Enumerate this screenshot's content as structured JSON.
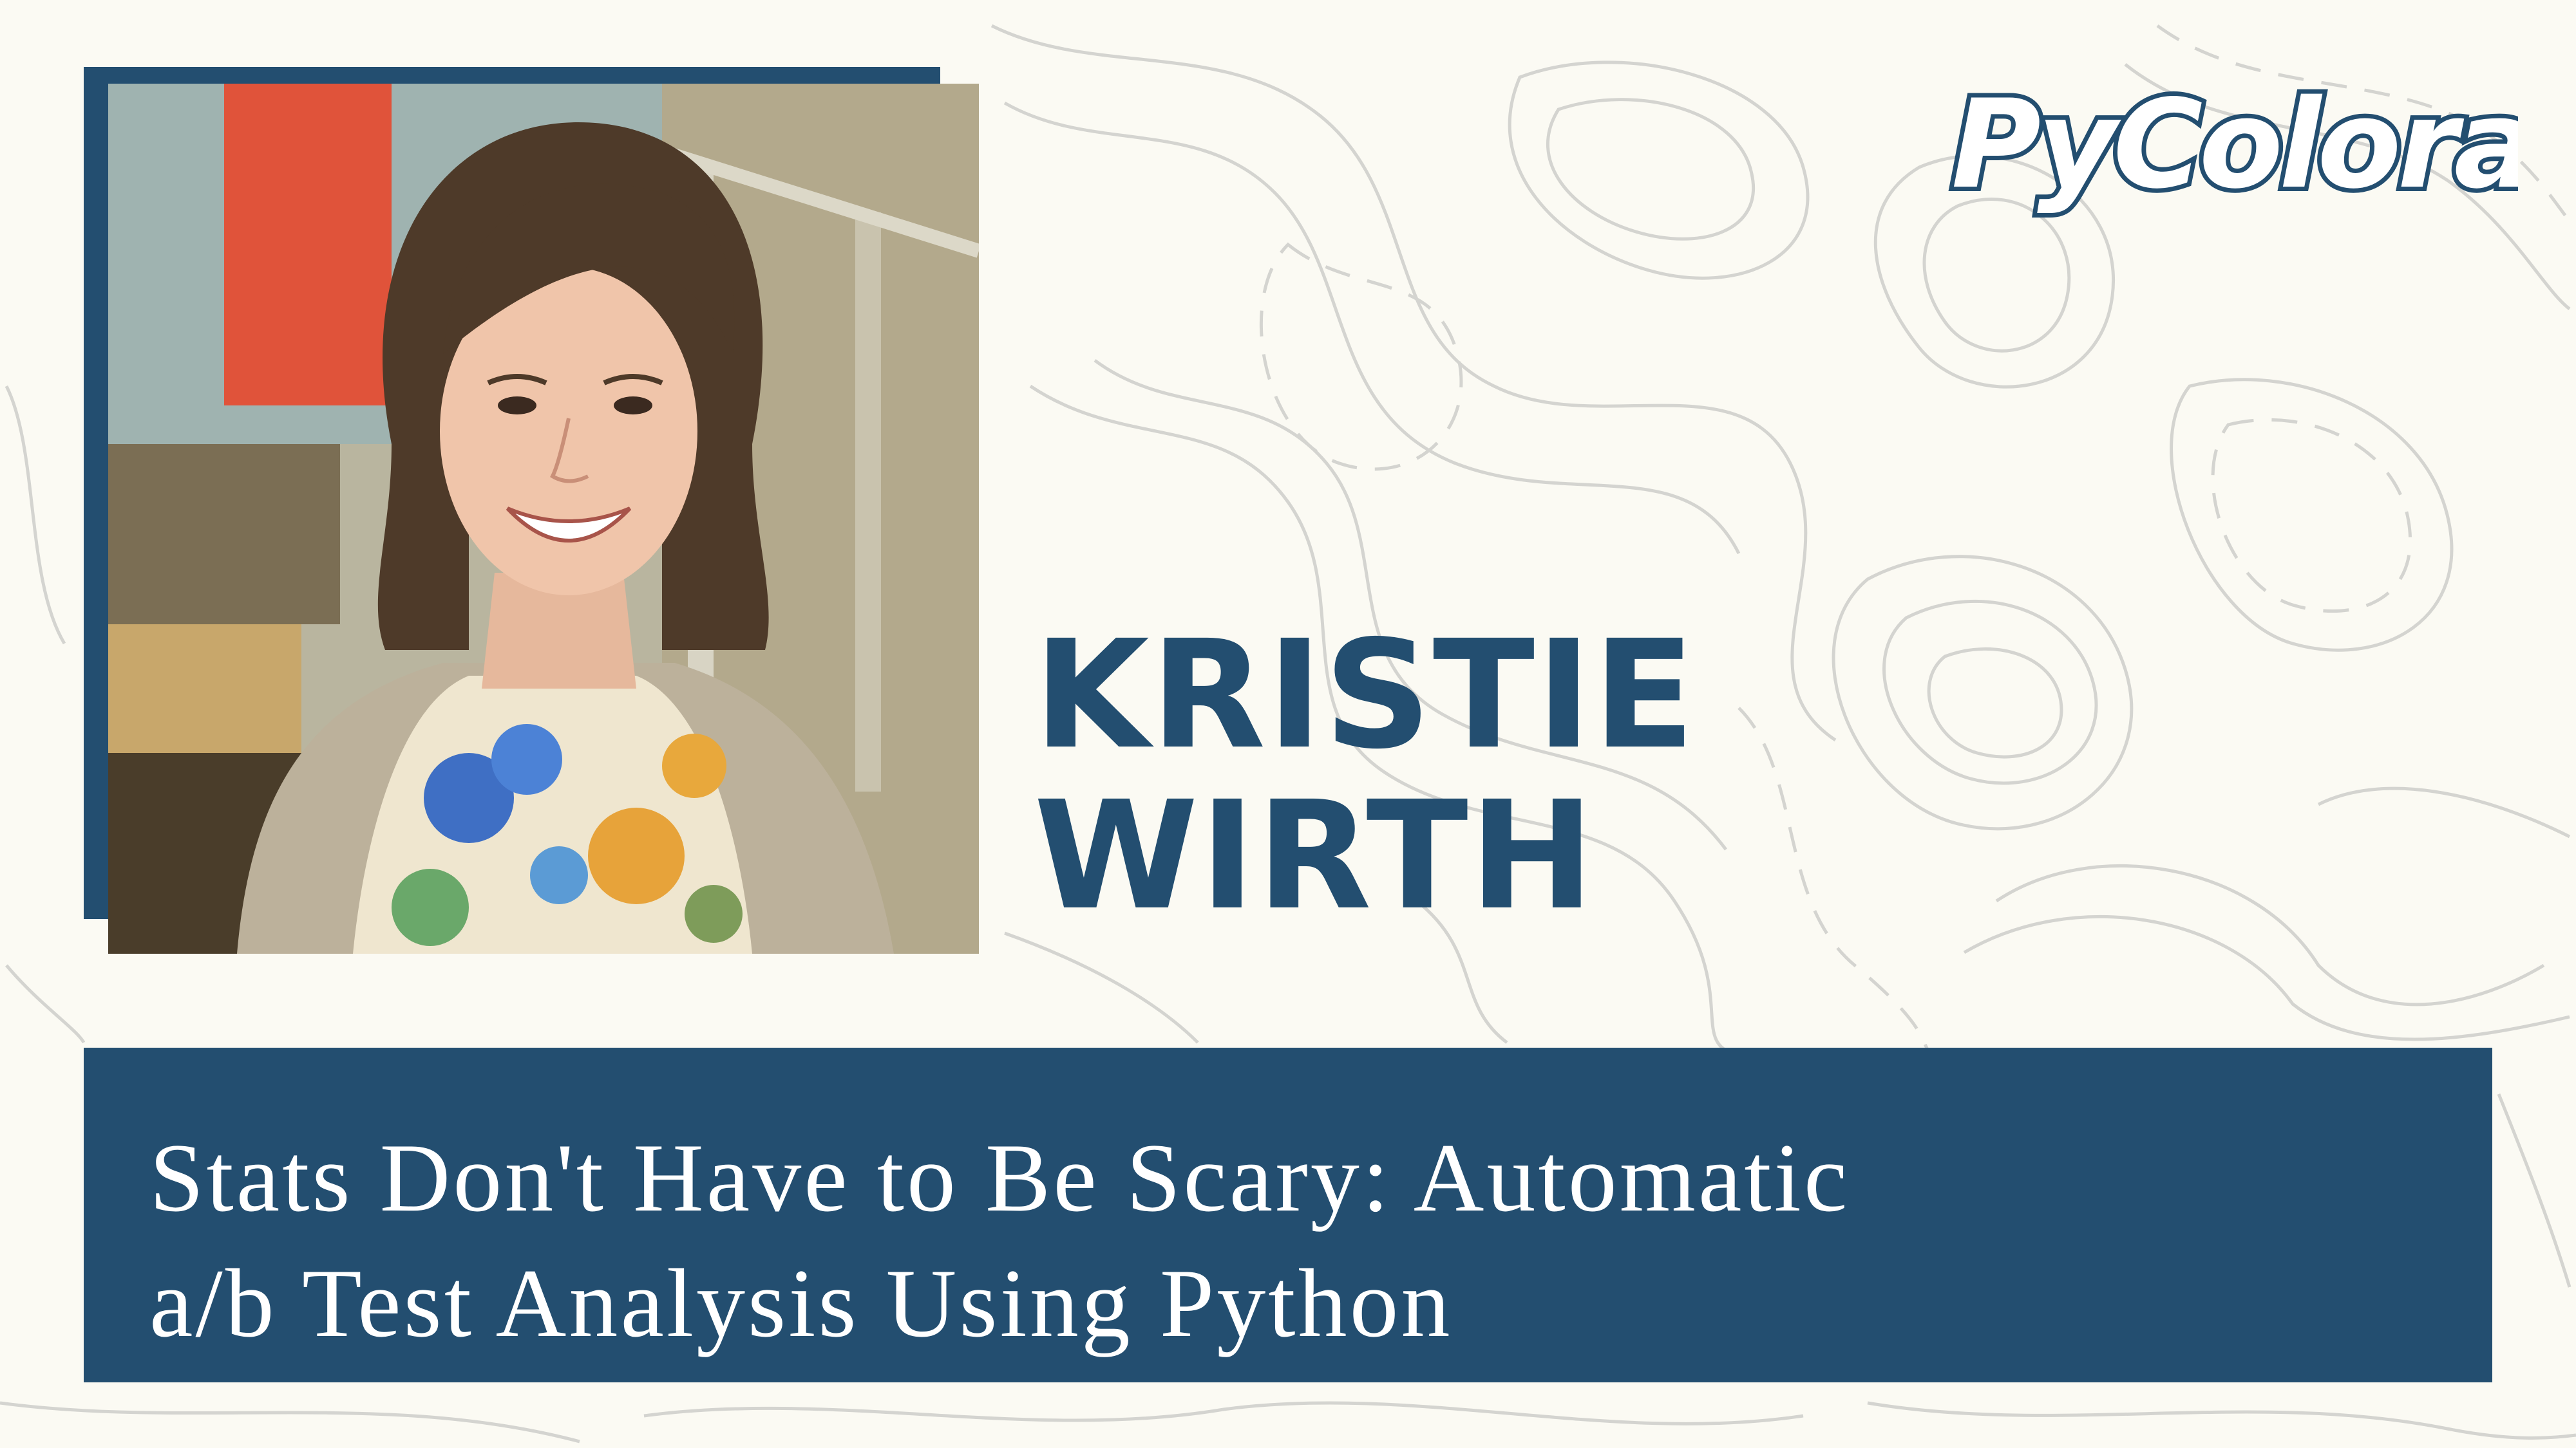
{
  "brand": {
    "logo_text": "PyColorado",
    "primary_color": "#234e70",
    "background_color": "#fbfaf3",
    "contour_color": "#d4d4d0"
  },
  "speaker": {
    "first_name": "KRISTIE",
    "last_name": "WIRTH",
    "photo": "speaker-portrait"
  },
  "talk": {
    "title_line_1": "Stats Don't Have to Be Scary: Automatic",
    "title_line_2": "a/b Test Analysis Using Python"
  }
}
